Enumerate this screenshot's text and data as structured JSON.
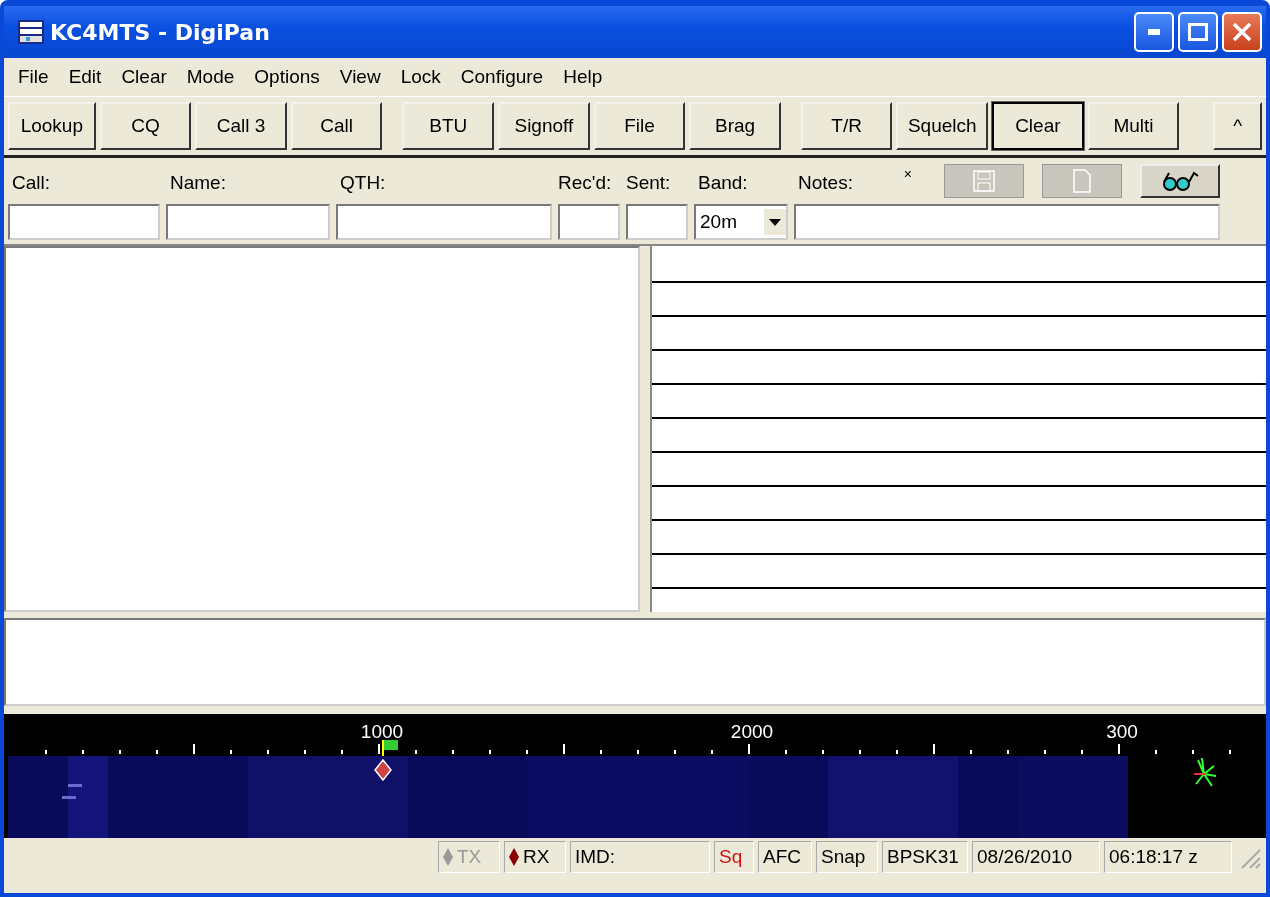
{
  "window": {
    "title": "KC4MTS - DigiPan"
  },
  "menu": [
    "File",
    "Edit",
    "Clear",
    "Mode",
    "Options",
    "View",
    "Lock",
    "Configure",
    "Help"
  ],
  "toolbar": [
    {
      "label": "Lookup",
      "group_start": false,
      "focused": false
    },
    {
      "label": "CQ",
      "group_start": false,
      "focused": false
    },
    {
      "label": "Call 3",
      "group_start": false,
      "focused": false
    },
    {
      "label": "Call",
      "group_start": false,
      "focused": false
    },
    {
      "label": "BTU",
      "group_start": true,
      "focused": false
    },
    {
      "label": "Signoff",
      "group_start": false,
      "focused": false
    },
    {
      "label": "File",
      "group_start": false,
      "focused": false
    },
    {
      "label": "Brag",
      "group_start": false,
      "focused": false
    },
    {
      "label": "T/R",
      "group_start": true,
      "focused": false
    },
    {
      "label": "Squelch",
      "group_start": false,
      "focused": false
    },
    {
      "label": "Clear",
      "group_start": false,
      "focused": true
    },
    {
      "label": "Multi",
      "group_start": false,
      "focused": false
    },
    {
      "label": "^",
      "group_start": true,
      "focused": false
    }
  ],
  "log": {
    "fields": [
      {
        "label": "Call:",
        "kind": "text"
      },
      {
        "label": "Name:",
        "kind": "text"
      },
      {
        "label": "QTH:",
        "kind": "text"
      },
      {
        "label": "Rec'd:",
        "kind": "text"
      },
      {
        "label": "Sent:",
        "kind": "text"
      },
      {
        "label": "Band:",
        "kind": "select",
        "value": "20m"
      },
      {
        "label": "Notes:",
        "kind": "text"
      }
    ],
    "modified_mark": "×",
    "buttons": [
      {
        "kind": "save",
        "disabled": true
      },
      {
        "kind": "new",
        "disabled": true
      },
      {
        "kind": "lookup",
        "disabled": false
      }
    ]
  },
  "waterfall": {
    "scale_labels": [
      "1000",
      "2000",
      "300"
    ]
  },
  "status_bar": [
    {
      "text": "TX",
      "kind": "indicator",
      "on": false
    },
    {
      "text": "RX",
      "kind": "indicator",
      "on": true
    },
    {
      "text": "IMD:",
      "kind": "text"
    },
    {
      "text": "Sq",
      "kind": "flag",
      "on": true
    },
    {
      "text": "AFC",
      "kind": "text"
    },
    {
      "text": "Snap",
      "kind": "text"
    },
    {
      "text": "BPSK31",
      "kind": "text"
    },
    {
      "text": "08/26/2010",
      "kind": "text"
    },
    {
      "text": "06:18:17 z",
      "kind": "text"
    }
  ]
}
